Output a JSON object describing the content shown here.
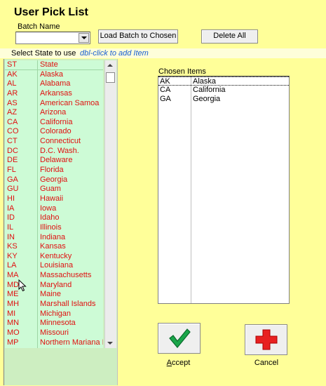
{
  "title": "User Pick List",
  "batch": {
    "label": "Batch Name",
    "value": ""
  },
  "buttons": {
    "load": "Load Batch to Chosen",
    "delete_all": "Delete All"
  },
  "source": {
    "label": "Select State to use",
    "hint": "dbl-click to add Item",
    "headers": [
      "ST",
      "State"
    ],
    "rows": [
      [
        "AK",
        "Alaska"
      ],
      [
        "AL",
        "Alabama"
      ],
      [
        "AR",
        "Arkansas"
      ],
      [
        "AS",
        "American Samoa"
      ],
      [
        "AZ",
        "Arizona"
      ],
      [
        "CA",
        "California"
      ],
      [
        "CO",
        "Colorado"
      ],
      [
        "CT",
        "Connecticut"
      ],
      [
        "DC",
        "D.C. Wash."
      ],
      [
        "DE",
        "Delaware"
      ],
      [
        "FL",
        "Florida"
      ],
      [
        "GA",
        "Georgia"
      ],
      [
        "GU",
        "Guam"
      ],
      [
        "HI",
        "Hawaii"
      ],
      [
        "IA",
        "Iowa"
      ],
      [
        "ID",
        "Idaho"
      ],
      [
        "IL",
        "Illinois"
      ],
      [
        "IN",
        "Indiana"
      ],
      [
        "KS",
        "Kansas"
      ],
      [
        "KY",
        "Kentucky"
      ],
      [
        "LA",
        "Louisiana"
      ],
      [
        "MA",
        "Massachusetts"
      ],
      [
        "MD",
        "Maryland"
      ],
      [
        "ME",
        "Maine"
      ],
      [
        "MH",
        "Marshall Islands"
      ],
      [
        "MI",
        "Michigan"
      ],
      [
        "MN",
        "Minnesota"
      ],
      [
        "MO",
        "Missouri"
      ],
      [
        "MP",
        "Northern Mariana Is"
      ]
    ]
  },
  "chosen": {
    "label": "Chosen Items",
    "rows": [
      [
        "AK",
        "Alaska"
      ],
      [
        "CA",
        "California"
      ],
      [
        "GA",
        "Georgia"
      ]
    ]
  },
  "actions": {
    "accept": "Accept",
    "cancel": "Cancel"
  },
  "icons": {
    "accept": "checkmark-icon",
    "cancel": "red-cross-icon",
    "combo": "chevron-down-icon"
  },
  "colors": {
    "background": "#ffff99",
    "list_bg": "#cdfbd6",
    "list_text": "#e01010",
    "hint": "#1a5fd3"
  }
}
